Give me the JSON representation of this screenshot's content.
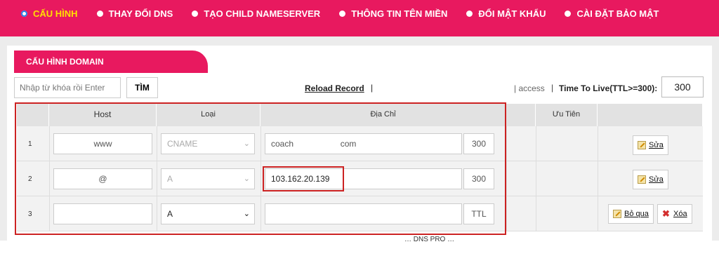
{
  "nav": {
    "items": [
      {
        "label": "CẤU HÌNH",
        "active": true
      },
      {
        "label": "THAY ĐỔI DNS",
        "active": false
      },
      {
        "label": "TẠO CHILD NAMESERVER",
        "active": false
      },
      {
        "label": "THÔNG TIN TÊN MIỀN",
        "active": false
      },
      {
        "label": "ĐỔI MẬT KHẨU",
        "active": false
      },
      {
        "label": "CÀI ĐẶT BẢO MẬT",
        "active": false
      }
    ]
  },
  "section": {
    "title": "CẤU HÌNH DOMAIN"
  },
  "search": {
    "placeholder": "Nhập từ khóa rồi Enter",
    "button_label": "TÌM"
  },
  "reload": {
    "label": "Reload Record",
    "separator": "|"
  },
  "access": {
    "label": "| access",
    "separator": "|"
  },
  "ttl": {
    "label": "Time To Live(TTL>=300):",
    "value": "300"
  },
  "table": {
    "headers": {
      "host": "Host",
      "type": "Loại",
      "address": "Địa Chỉ",
      "priority": "Ưu Tiên"
    },
    "rows": [
      {
        "num": "1",
        "host": "www",
        "type": "CNAME",
        "address": "coach                    com",
        "ttl": "300",
        "actions": [
          "Sửa"
        ]
      },
      {
        "num": "2",
        "host": "@",
        "type": "A",
        "address": "103.162.20.139",
        "ttl": "300",
        "actions": [
          "Sửa"
        ]
      },
      {
        "num": "3",
        "host": "",
        "type": "A",
        "address": "",
        "ttl": "TTL",
        "actions": [
          "Bỏ qua",
          "Xóa"
        ]
      }
    ]
  },
  "icons": {
    "radio": "radio-dot-icon",
    "edit": "edit-icon",
    "delete": "close-x-icon",
    "chevron": "chevron-down-icon"
  },
  "colors": {
    "brand": "#e8195f",
    "active_nav": "#ffe000",
    "highlight": "#cc2222"
  },
  "footer": {
    "partial_text": "… DNS PRO …"
  }
}
